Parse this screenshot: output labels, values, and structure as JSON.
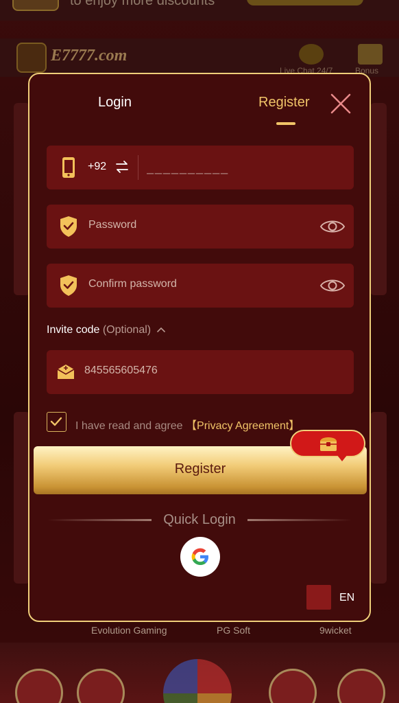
{
  "background": {
    "promo_text": "to enjoy more discounts",
    "logo_text": "E7777.com",
    "header_icons": [
      {
        "label": "Live Chat 24/7",
        "icon": "headset-icon"
      },
      {
        "label": "Bonus",
        "icon": "gift-icon"
      }
    ],
    "game_providers": [
      "Evolution Gaming",
      "PG Soft",
      "9wicket"
    ]
  },
  "modal": {
    "tabs": {
      "login": "Login",
      "register": "Register",
      "active": "register"
    },
    "phone": {
      "country_code": "+92",
      "placeholder": "__________"
    },
    "password": {
      "placeholder": "Password"
    },
    "confirm_password": {
      "placeholder": "Confirm password"
    },
    "invite": {
      "label": "Invite code",
      "optional": "(Optional)",
      "value": "845565605476"
    },
    "agreement": {
      "checked": true,
      "text": "I have read and agree",
      "link": "【Privacy Agreement】"
    },
    "register_button": "Register",
    "quick_login": {
      "title": "Quick Login",
      "providers": [
        "google-icon"
      ]
    },
    "language": "EN"
  },
  "colors": {
    "modal_bg": "#420b0b",
    "field_bg": "#6a1212",
    "accent_gold": "#f1c468",
    "border_gold": "#f0cf7a",
    "button_text": "#5a1a0e",
    "gift_red": "#d11818"
  }
}
